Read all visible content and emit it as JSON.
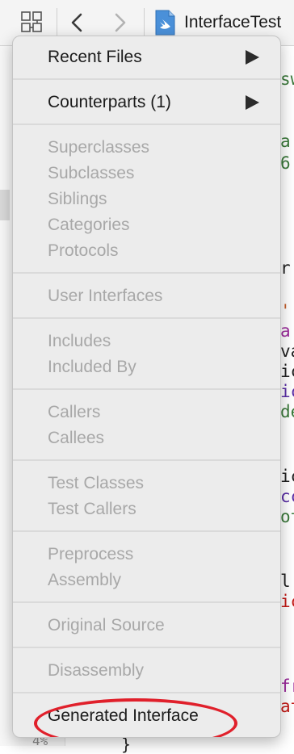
{
  "toolbar": {
    "file_title": "InterfaceTest",
    "icons": [
      "related-items-grid-icon",
      "back-chevron-icon",
      "forward-chevron-icon",
      "swift-file-icon"
    ]
  },
  "menu": {
    "recent_files": "Recent Files",
    "counterparts": "Counterparts (1)",
    "superclasses": "Superclasses",
    "subclasses": "Subclasses",
    "siblings": "Siblings",
    "categories": "Categories",
    "protocols": "Protocols",
    "user_interfaces": "User Interfaces",
    "includes": "Includes",
    "included_by": "Included By",
    "callers": "Callers",
    "callees": "Callees",
    "test_classes": "Test Classes",
    "test_callers": "Test Callers",
    "preprocess": "Preprocess",
    "assembly": "Assembly",
    "original_source": "Original Source",
    "disassembly": "Disassembly",
    "generated_interface": "Generated Interface"
  },
  "highlight_color": "#e0202b",
  "code_fragments": [
    {
      "text": "sw",
      "color": "#3b7a3b"
    },
    {
      "text": "a",
      "color": "#3b7a3b"
    },
    {
      "text": "6",
      "color": "#3b7a3b"
    },
    {
      "text": "r",
      "color": "#222222"
    },
    {
      "text": "'",
      "color": "#c45d2b"
    },
    {
      "text": "a",
      "color": "#9b2a9b"
    },
    {
      "text": "va",
      "color": "#222222"
    },
    {
      "text": "ic",
      "color": "#222222"
    },
    {
      "text": "ic",
      "color": "#5a2ea6"
    },
    {
      "text": "de",
      "color": "#3b7a3b"
    },
    {
      "text": "ic",
      "color": "#222222"
    },
    {
      "text": "cc",
      "color": "#5a2ea6"
    },
    {
      "text": "ot",
      "color": "#3b7a3b"
    },
    {
      "text": "l",
      "color": "#222222"
    },
    {
      "text": "ic",
      "color": "#c41a16"
    },
    {
      "text": "fr",
      "color": "#9b2a9b"
    },
    {
      "text": "at",
      "color": "#c41a16"
    }
  ],
  "gutter_number": "4%",
  "code_bottom": "}"
}
